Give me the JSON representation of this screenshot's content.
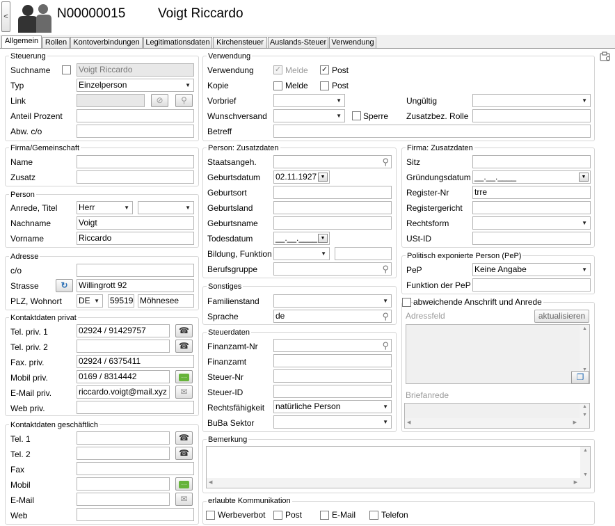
{
  "header": {
    "collapse_glyph": "<",
    "record_id": "N00000015",
    "record_name": "Voigt Riccardo",
    "icon": "people-icon"
  },
  "tabs": [
    "Allgemein",
    "Rollen",
    "Kontoverbindungen",
    "Legitimationsdaten",
    "Kirchensteuer",
    "Auslands-Steuer",
    "Verwendung"
  ],
  "active_tab": "Allgemein",
  "steuerung": {
    "title": "Steuerung",
    "suchname_label": "Suchname",
    "suchname_value": "Voigt Riccardo",
    "typ_label": "Typ",
    "typ_value": "Einzelperson",
    "link_label": "Link",
    "link_value": "",
    "anteil_label": "Anteil Prozent",
    "anteil_value": "",
    "abw_label": "Abw. c/o",
    "abw_value": ""
  },
  "firma": {
    "title": "Firma/Gemeinschaft",
    "name_label": "Name",
    "zusatz_label": "Zusatz"
  },
  "person": {
    "title": "Person",
    "anrede_label": "Anrede, Titel",
    "anrede_value": "Herr",
    "titel_value": "",
    "nachname_label": "Nachname",
    "nachname_value": "Voigt",
    "vorname_label": "Vorname",
    "vorname_value": "Riccardo"
  },
  "adresse": {
    "title": "Adresse",
    "co_label": "c/o",
    "strasse_label": "Strasse",
    "strasse_value": "Willingrott 92",
    "plz_label": "PLZ, Wohnort",
    "land_value": "DE",
    "plz_value": "59519",
    "ort_value": "Möhnesee"
  },
  "kontakt_privat": {
    "title": "Kontaktdaten privat",
    "tel1_label": "Tel. priv. 1",
    "tel1_value": "02924 / 91429757",
    "tel2_label": "Tel. priv. 2",
    "tel2_value": "",
    "fax_label": "Fax. priv.",
    "fax_value": "02924 / 6375411",
    "mobil_label": "Mobil priv.",
    "mobil_value": "0169 / 8314442",
    "email_label": "E-Mail priv.",
    "email_value": "riccardo.voigt@mail.xyz",
    "web_label": "Web priv.",
    "web_value": ""
  },
  "kontakt_geschaeftlich": {
    "title": "Kontaktdaten geschäftlich",
    "tel1_label": "Tel. 1",
    "tel2_label": "Tel. 2",
    "fax_label": "Fax",
    "mobil_label": "Mobil",
    "email_label": "E-Mail",
    "web_label": "Web"
  },
  "verwendung": {
    "title": "Verwendung",
    "verwendung_label": "Verwendung",
    "melde_label": "Melde",
    "post_label": "Post",
    "verwendung_melde_checked": true,
    "verwendung_post_checked": true,
    "kopie_label": "Kopie",
    "kopie_melde_checked": false,
    "kopie_post_checked": false,
    "vorbrief_label": "Vorbrief",
    "wunschversand_label": "Wunschversand",
    "sperre_label": "Sperre",
    "betreff_label": "Betreff",
    "ungueltig_label": "Ungültig",
    "zusatzbez_label": "Zusatzbez. Rolle"
  },
  "person_zusatz": {
    "title": "Person: Zusatzdaten",
    "staatsangeh_label": "Staatsangeh.",
    "geburtsdatum_label": "Geburtsdatum",
    "geburtsdatum_value": "02.11.1927",
    "geburtsort_label": "Geburtsort",
    "geburtsland_label": "Geburtsland",
    "geburtsname_label": "Geburtsname",
    "todesdatum_label": "Todesdatum",
    "todesdatum_value": "__.__.____",
    "bildung_label": "Bildung, Funktion",
    "berufsgruppe_label": "Berufsgruppe"
  },
  "sonstiges": {
    "title": "Sonstiges",
    "familienstand_label": "Familienstand",
    "sprache_label": "Sprache",
    "sprache_value": "de"
  },
  "steuerdaten": {
    "title": "Steuerdaten",
    "finanzamt_nr_label": "Finanzamt-Nr",
    "finanzamt_label": "Finanzamt",
    "steuer_nr_label": "Steuer-Nr",
    "steuer_id_label": "Steuer-ID",
    "rechtsfaehigkeit_label": "Rechtsfähigkeit",
    "rechtsfaehigkeit_value": "natürliche Person",
    "buba_label": "BuBa Sektor"
  },
  "firma_zusatz": {
    "title": "Firma: Zusatzdaten",
    "sitz_label": "Sitz",
    "gruendungsdatum_label": "Gründungsdatum",
    "gruendungsdatum_value": "__.__.____",
    "register_nr_label": "Register-Nr",
    "register_nr_value": "trre",
    "registergericht_label": "Registergericht",
    "rechtsform_label": "Rechtsform",
    "ust_label": "USt-ID"
  },
  "pep": {
    "title": "Politisch exponierte Person (PeP)",
    "pep_label": "PeP",
    "pep_value": "Keine Angabe",
    "funktion_label": "Funktion der PeP"
  },
  "abweichend": {
    "label": "abweichende Anschrift und Anrede",
    "adressfeld_label": "Adressfeld",
    "aktualisieren_label": "aktualisieren",
    "briefanrede_label": "Briefanrede"
  },
  "bemerkung": {
    "title": "Bemerkung"
  },
  "kommunikation": {
    "title": "erlaubte Kommunikation",
    "werbeverbot_label": "Werbeverbot",
    "post_label": "Post",
    "email_label": "E-Mail",
    "telefon_label": "Telefon"
  },
  "colors": {
    "frame_border": "#d5d5d5",
    "disabled_bg": "#e8e8e8",
    "accent": "#2a6fb5"
  }
}
